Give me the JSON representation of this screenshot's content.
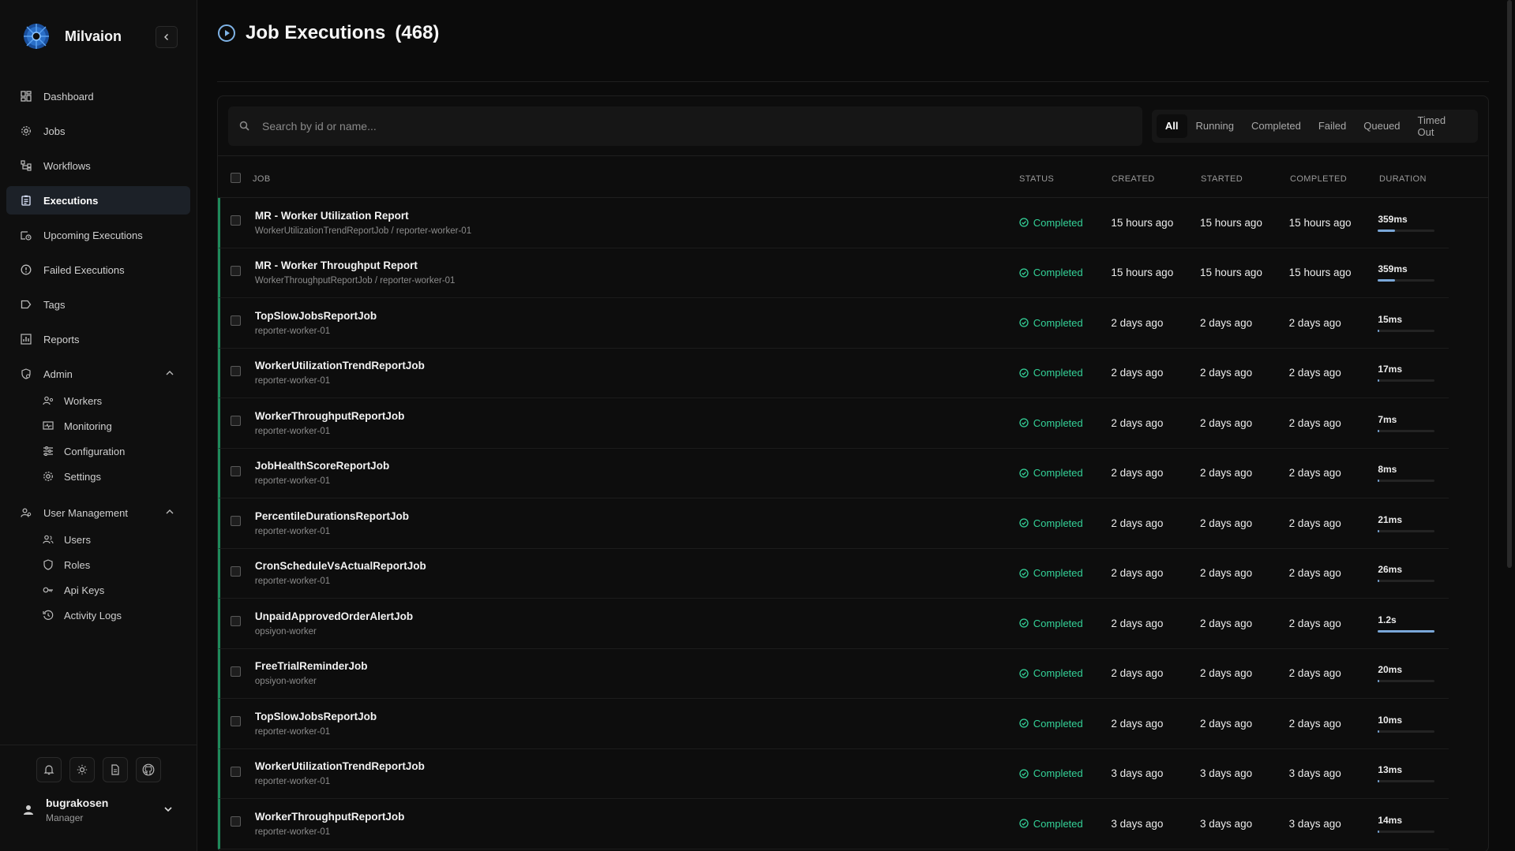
{
  "app": {
    "name": "Milvaion"
  },
  "sidebar": {
    "items": [
      {
        "label": "Dashboard",
        "icon": "dashboard-icon",
        "active": false
      },
      {
        "label": "Jobs",
        "icon": "gear-icon",
        "active": false
      },
      {
        "label": "Workflows",
        "icon": "workflow-icon",
        "active": false
      },
      {
        "label": "Executions",
        "icon": "clipboard-icon",
        "active": true
      },
      {
        "label": "Upcoming Executions",
        "icon": "calendar-clock-icon",
        "active": false
      },
      {
        "label": "Failed Executions",
        "icon": "alert-circle-icon",
        "active": false
      },
      {
        "label": "Tags",
        "icon": "tag-icon",
        "active": false
      },
      {
        "label": "Reports",
        "icon": "chart-icon",
        "active": false
      }
    ],
    "admin": {
      "label": "Admin",
      "items": [
        {
          "label": "Workers",
          "icon": "users-cog-icon"
        },
        {
          "label": "Monitoring",
          "icon": "monitor-icon"
        },
        {
          "label": "Configuration",
          "icon": "sliders-icon"
        },
        {
          "label": "Settings",
          "icon": "gear-icon"
        }
      ]
    },
    "user_management": {
      "label": "User Management",
      "items": [
        {
          "label": "Users",
          "icon": "users-icon"
        },
        {
          "label": "Roles",
          "icon": "shield-icon"
        },
        {
          "label": "Api Keys",
          "icon": "key-icon"
        },
        {
          "label": "Activity Logs",
          "icon": "history-icon"
        }
      ]
    },
    "footer_icons": [
      "bell-icon",
      "sun-icon",
      "document-icon",
      "github-icon"
    ],
    "user": {
      "name": "bugrakosen",
      "role": "Manager"
    }
  },
  "page": {
    "title": "Job Executions",
    "count": "(468)"
  },
  "search": {
    "placeholder": "Search by id or name..."
  },
  "filters": [
    {
      "label": "All",
      "active": true
    },
    {
      "label": "Running",
      "active": false
    },
    {
      "label": "Completed",
      "active": false
    },
    {
      "label": "Failed",
      "active": false
    },
    {
      "label": "Queued",
      "active": false
    },
    {
      "label": "Timed Out",
      "active": false
    }
  ],
  "table": {
    "columns": {
      "job": "JOB",
      "status": "STATUS",
      "created": "CREATED",
      "started": "STARTED",
      "completed": "COMPLETED",
      "duration": "DURATION"
    },
    "rows": [
      {
        "name": "MR - Worker Utilization Report",
        "sub": "WorkerUtilizationTrendReportJob / reporter-worker-01",
        "status": "Completed",
        "created": "15 hours ago",
        "started": "15 hours ago",
        "completed": "15 hours ago",
        "duration": "359ms",
        "duration_fraction": 0.3
      },
      {
        "name": "MR - Worker Throughput Report",
        "sub": "WorkerThroughputReportJob / reporter-worker-01",
        "status": "Completed",
        "created": "15 hours ago",
        "started": "15 hours ago",
        "completed": "15 hours ago",
        "duration": "359ms",
        "duration_fraction": 0.3
      },
      {
        "name": "TopSlowJobsReportJob",
        "sub": "reporter-worker-01",
        "status": "Completed",
        "created": "2 days ago",
        "started": "2 days ago",
        "completed": "2 days ago",
        "duration": "15ms",
        "duration_fraction": 0.02
      },
      {
        "name": "WorkerUtilizationTrendReportJob",
        "sub": "reporter-worker-01",
        "status": "Completed",
        "created": "2 days ago",
        "started": "2 days ago",
        "completed": "2 days ago",
        "duration": "17ms",
        "duration_fraction": 0.02
      },
      {
        "name": "WorkerThroughputReportJob",
        "sub": "reporter-worker-01",
        "status": "Completed",
        "created": "2 days ago",
        "started": "2 days ago",
        "completed": "2 days ago",
        "duration": "7ms",
        "duration_fraction": 0.01
      },
      {
        "name": "JobHealthScoreReportJob",
        "sub": "reporter-worker-01",
        "status": "Completed",
        "created": "2 days ago",
        "started": "2 days ago",
        "completed": "2 days ago",
        "duration": "8ms",
        "duration_fraction": 0.01
      },
      {
        "name": "PercentileDurationsReportJob",
        "sub": "reporter-worker-01",
        "status": "Completed",
        "created": "2 days ago",
        "started": "2 days ago",
        "completed": "2 days ago",
        "duration": "21ms",
        "duration_fraction": 0.02
      },
      {
        "name": "CronScheduleVsActualReportJob",
        "sub": "reporter-worker-01",
        "status": "Completed",
        "created": "2 days ago",
        "started": "2 days ago",
        "completed": "2 days ago",
        "duration": "26ms",
        "duration_fraction": 0.02
      },
      {
        "name": "UnpaidApprovedOrderAlertJob",
        "sub": "opsiyon-worker",
        "status": "Completed",
        "created": "2 days ago",
        "started": "2 days ago",
        "completed": "2 days ago",
        "duration": "1.2s",
        "duration_fraction": 1.0
      },
      {
        "name": "FreeTrialReminderJob",
        "sub": "opsiyon-worker",
        "status": "Completed",
        "created": "2 days ago",
        "started": "2 days ago",
        "completed": "2 days ago",
        "duration": "20ms",
        "duration_fraction": 0.02
      },
      {
        "name": "TopSlowJobsReportJob",
        "sub": "reporter-worker-01",
        "status": "Completed",
        "created": "2 days ago",
        "started": "2 days ago",
        "completed": "2 days ago",
        "duration": "10ms",
        "duration_fraction": 0.01
      },
      {
        "name": "WorkerUtilizationTrendReportJob",
        "sub": "reporter-worker-01",
        "status": "Completed",
        "created": "3 days ago",
        "started": "3 days ago",
        "completed": "3 days ago",
        "duration": "13ms",
        "duration_fraction": 0.01
      },
      {
        "name": "WorkerThroughputReportJob",
        "sub": "reporter-worker-01",
        "status": "Completed",
        "created": "3 days ago",
        "started": "3 days ago",
        "completed": "3 days ago",
        "duration": "14ms",
        "duration_fraction": 0.01
      }
    ]
  },
  "colors": {
    "accent": "#34d399",
    "active_bg": "#1c2128",
    "bar": "#7aa7d8"
  }
}
